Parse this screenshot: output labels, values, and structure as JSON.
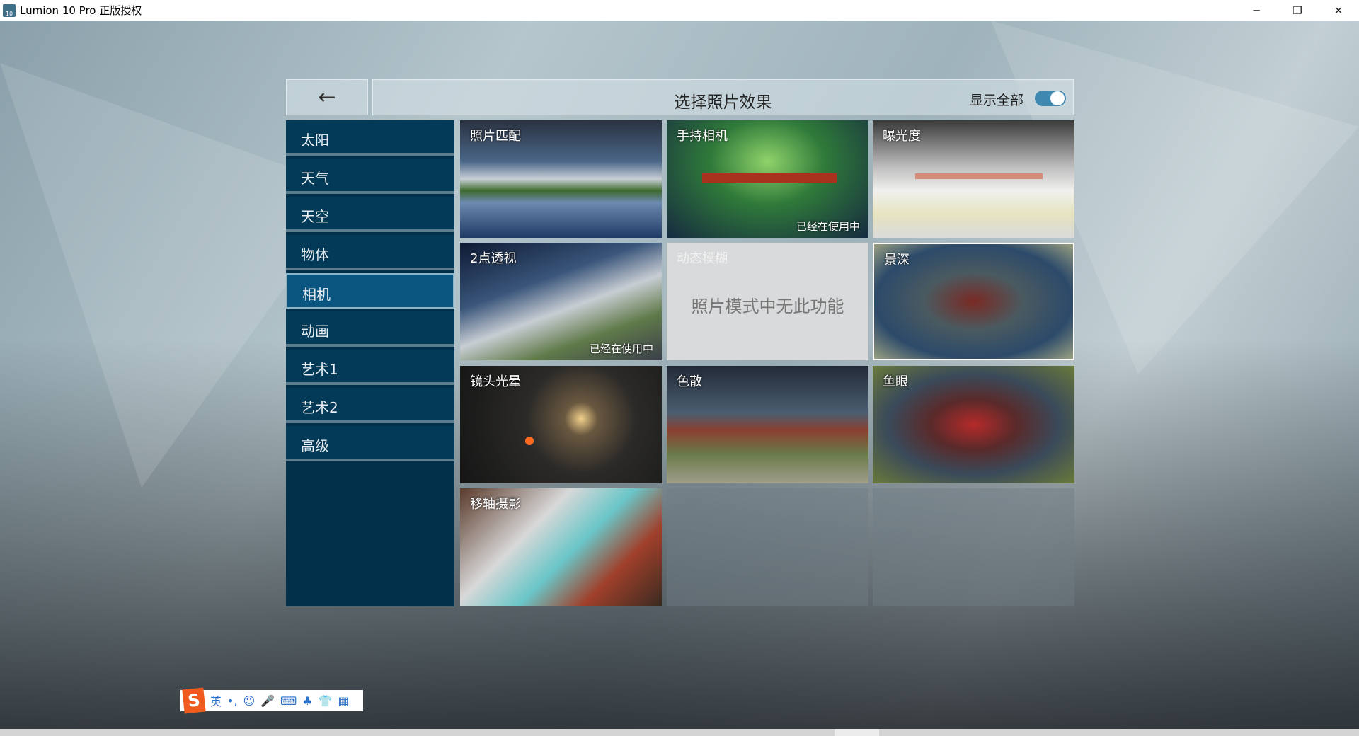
{
  "window": {
    "title": "Lumion 10 Pro 正版授权",
    "icon": "lumion-app-icon",
    "icon_text": "10"
  },
  "header": {
    "title": "选择照片效果",
    "show_all_label": "显示全部",
    "show_all_on": true,
    "back_icon": "←"
  },
  "sidebar": {
    "items": [
      {
        "label": "太阳"
      },
      {
        "label": "天气"
      },
      {
        "label": "天空"
      },
      {
        "label": "物体"
      },
      {
        "label": "相机",
        "active": true
      },
      {
        "label": "动画"
      },
      {
        "label": "艺术1"
      },
      {
        "label": "艺术2"
      },
      {
        "label": "高级"
      }
    ]
  },
  "effects": [
    {
      "label": "照片匹配"
    },
    {
      "label": "手持相机",
      "status": "已经在使用中"
    },
    {
      "label": "曝光度"
    },
    {
      "label": "2点透视",
      "status": "已经在使用中"
    },
    {
      "label": "动态模糊",
      "disabled_message": "照片模式中无此功能"
    },
    {
      "label": "景深"
    },
    {
      "label": "镜头光晕"
    },
    {
      "label": "色散"
    },
    {
      "label": "鱼眼"
    },
    {
      "label": "移轴摄影"
    }
  ],
  "ime": {
    "logo": "S",
    "mode": "英",
    "punct": "•,",
    "icons": [
      "☺",
      "🎤",
      "⌨",
      "♣",
      "👕",
      "▦"
    ]
  }
}
